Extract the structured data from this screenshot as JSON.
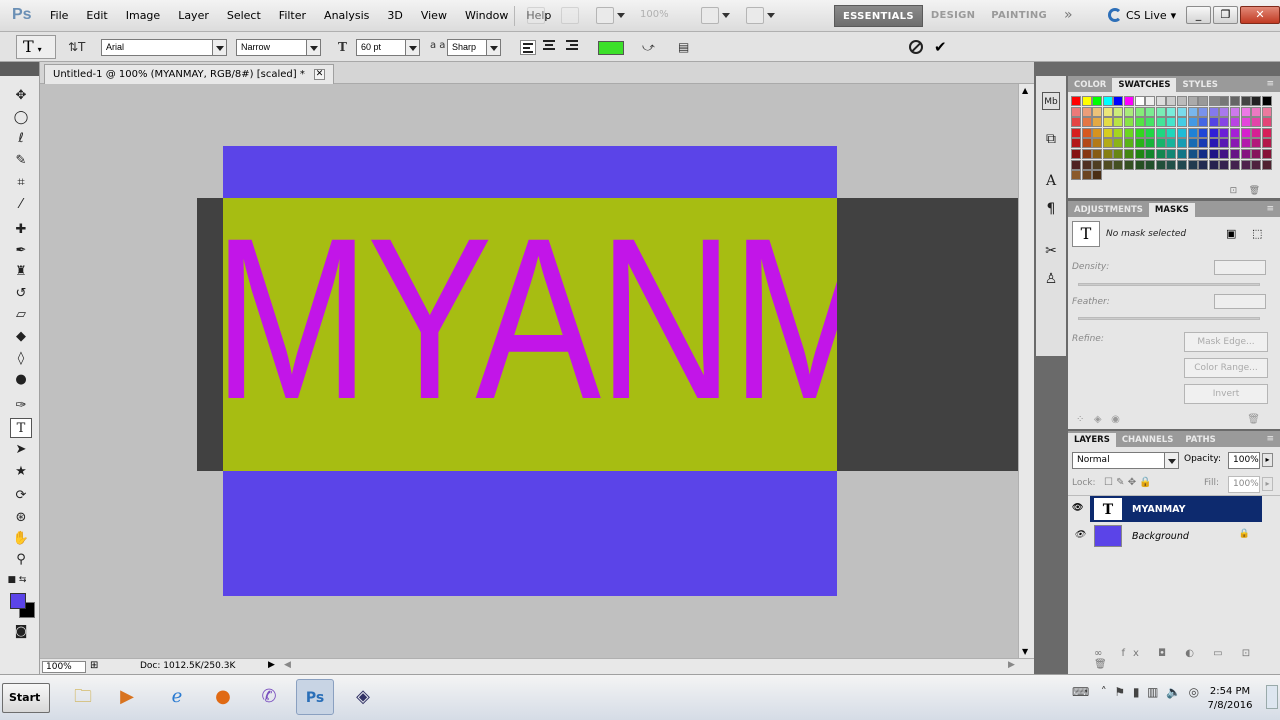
{
  "app": {
    "logo": "Ps"
  },
  "menu": [
    "File",
    "Edit",
    "Image",
    "Layer",
    "Select",
    "Filter",
    "Analysis",
    "3D",
    "View",
    "Window",
    "Help"
  ],
  "menubar": {
    "zoom": "100%"
  },
  "workspaces": [
    "ESSENTIALS",
    "DESIGN",
    "PAINTING"
  ],
  "cs_live": "CS Live",
  "options": {
    "font_family": "Arial",
    "font_style": "Narrow",
    "font_size": "60 pt",
    "antialias_icon": "a a",
    "antialias": "Sharp",
    "text_color": "#3ce02a"
  },
  "document": {
    "tab_title": "Untitled-1 @ 100% (MYANMAY, RGB/8#) [scaled] *",
    "canvas_text": "MYANM",
    "bg_color": "#5b44e8",
    "band_color": "#a7bd12",
    "text_fill": "#c215e8",
    "zoom": "100%",
    "doc_info": "Doc: 1012.5K/250.3K"
  },
  "toolbox": {
    "fg_color": "#5b44e8",
    "bg_color": "#000000"
  },
  "panels": {
    "swatch_tabs": [
      "COLOR",
      "SWATCHES",
      "STYLES"
    ],
    "mask_tabs": [
      "ADJUSTMENTS",
      "MASKS"
    ],
    "no_mask": "No mask selected",
    "density": "Density:",
    "feather": "Feather:",
    "refine": "Refine:",
    "mask_edge": "Mask Edge...",
    "color_range": "Color Range...",
    "invert": "Invert",
    "layer_tabs": [
      "LAYERS",
      "CHANNELS",
      "PATHS"
    ],
    "blend_mode": "Normal",
    "opacity_label": "Opacity:",
    "opacity": "100%",
    "lock_label": "Lock:",
    "fill_label": "Fill:",
    "fill": "100%",
    "layers": [
      {
        "name": "MYANMAY",
        "kind": "text",
        "selected": true
      },
      {
        "name": "Background",
        "kind": "fill",
        "color": "#5b44e8",
        "locked": true
      }
    ]
  },
  "taskbar": {
    "start": "Start",
    "time": "2:54 PM",
    "date": "7/8/2016"
  }
}
